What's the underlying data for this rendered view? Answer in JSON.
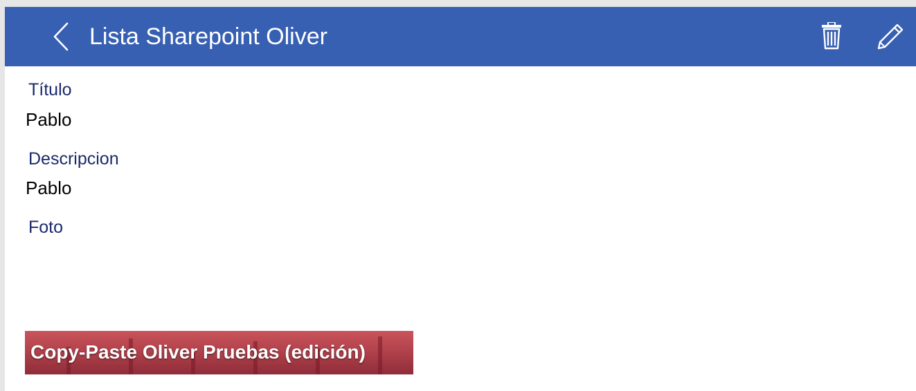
{
  "header": {
    "title": "Lista Sharepoint Oliver",
    "background_color": "#3860b2",
    "back_icon": "chevron-left-icon",
    "delete_icon": "trash-icon",
    "edit_icon": "pencil-icon"
  },
  "fields": [
    {
      "label": "Título",
      "value": "Pablo"
    },
    {
      "label": "Descripcion",
      "value": "Pablo"
    },
    {
      "label": "Foto"
    }
  ],
  "photo": {
    "caption": "Copy-Paste Oliver Pruebas (edición)"
  },
  "colors": {
    "label": "#1b2a6b",
    "value": "#000000"
  }
}
